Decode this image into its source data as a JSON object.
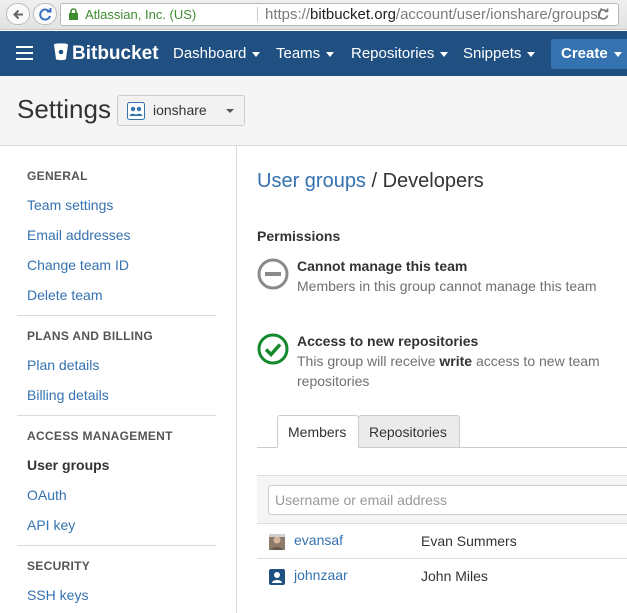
{
  "browser": {
    "identity": "Atlassian, Inc. (US)",
    "url_prefix": "https://",
    "url_domain": "bitbucket.org",
    "url_path": "/account/user/ionshare/groups/"
  },
  "header": {
    "brand": "Bitbucket",
    "nav": [
      "Dashboard",
      "Teams",
      "Repositories",
      "Snippets"
    ],
    "create_label": "Create",
    "color": "#205081"
  },
  "settings": {
    "title": "Settings",
    "team_name": "ionshare"
  },
  "sidebar": {
    "sections": [
      {
        "heading": "GENERAL",
        "items": [
          "Team settings",
          "Email addresses",
          "Change team ID",
          "Delete team"
        ]
      },
      {
        "heading": "PLANS AND BILLING",
        "items": [
          "Plan details",
          "Billing details"
        ]
      },
      {
        "heading": "ACCESS MANAGEMENT",
        "items": [
          "User groups",
          "OAuth",
          "API key"
        ]
      },
      {
        "heading": "SECURITY",
        "items": [
          "SSH keys"
        ]
      }
    ],
    "active_item": "User groups"
  },
  "main": {
    "breadcrumb_link": "User groups",
    "breadcrumb_sep": " / ",
    "breadcrumb_current": "Developers",
    "permissions_heading": "Permissions",
    "permissions": [
      {
        "title": "Cannot manage this team",
        "description": "Members in this group cannot manage this team",
        "icon": "no-entry-icon"
      },
      {
        "title": "Access to new repositories",
        "description_prefix": "This group will receive ",
        "description_bold": "write",
        "description_suffix": " access to new team repositories",
        "icon": "check-circle-icon"
      }
    ],
    "tabs": [
      "Members",
      "Repositories"
    ],
    "search_placeholder": "Username or email address",
    "members": [
      {
        "username": "evansaf",
        "name": "Evan Summers"
      },
      {
        "username": "johnzaar",
        "name": "John Miles"
      }
    ]
  }
}
